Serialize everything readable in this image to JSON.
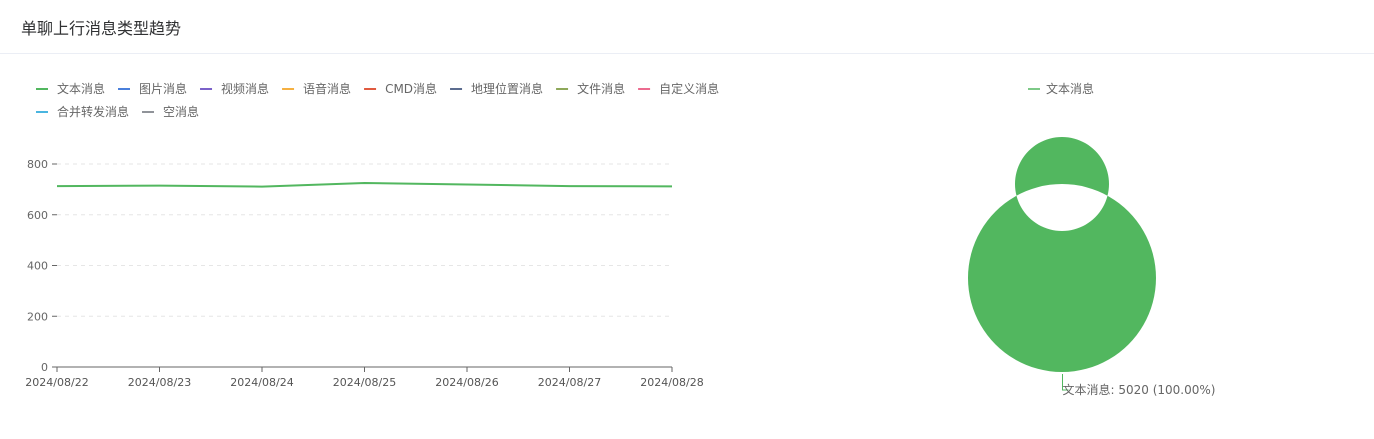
{
  "header": {
    "title": "单聊上行消息类型趋势"
  },
  "chart_data": [
    {
      "type": "line",
      "title": "",
      "xlabel": "",
      "ylabel": "",
      "categories": [
        "2024/08/22",
        "2024/08/23",
        "2024/08/24",
        "2024/08/25",
        "2024/08/26",
        "2024/08/27",
        "2024/08/28"
      ],
      "ylim": [
        0,
        800
      ],
      "yticks": [
        0,
        200,
        400,
        600,
        800
      ],
      "grid": true,
      "legend_position": "top-left",
      "series": [
        {
          "name": "文本消息",
          "color": "#52b75f",
          "values": [
            713,
            715,
            711,
            725,
            719,
            713,
            712
          ]
        },
        {
          "name": "图片消息",
          "color": "#4a7fdb",
          "values": []
        },
        {
          "name": "视频消息",
          "color": "#7b61c9",
          "values": []
        },
        {
          "name": "语音消息",
          "color": "#f5b041",
          "values": []
        },
        {
          "name": "CMD消息",
          "color": "#e05a3f",
          "values": []
        },
        {
          "name": "地理位置消息",
          "color": "#5b6c8f",
          "values": []
        },
        {
          "name": "文件消息",
          "color": "#8ea85a",
          "values": []
        },
        {
          "name": "自定义消息",
          "color": "#ec6b8f",
          "values": []
        },
        {
          "name": "合并转发消息",
          "color": "#4ab5e0",
          "values": []
        },
        {
          "name": "空消息",
          "color": "#909399",
          "values": []
        }
      ]
    },
    {
      "type": "pie",
      "title": "",
      "legend_position": "top",
      "slices": [
        {
          "name": "文本消息",
          "value": 5020,
          "percent": "100.00%",
          "color": "#52b75f",
          "label": "文本消息: 5020 (100.00%)"
        }
      ]
    }
  ]
}
